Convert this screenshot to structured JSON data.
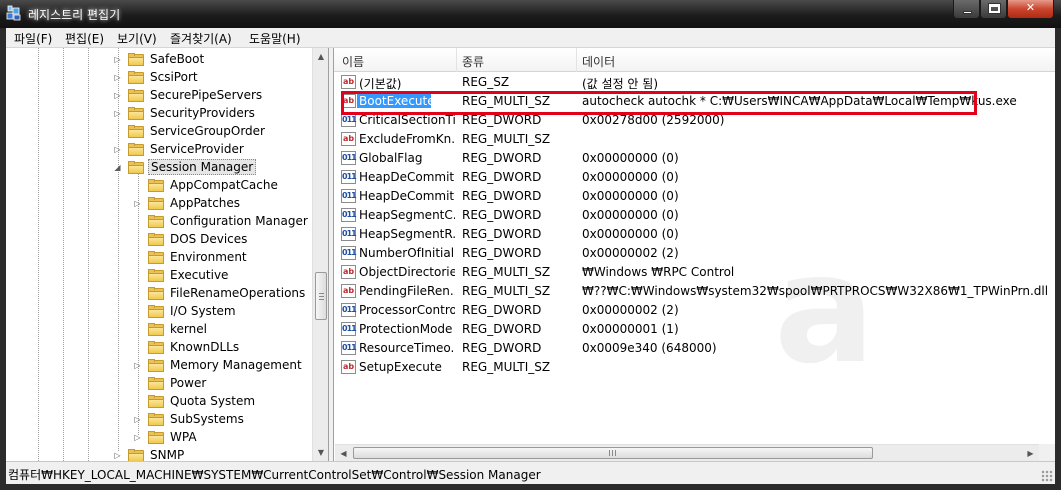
{
  "window": {
    "title": "레지스트리 편집기",
    "icon": "registry-editor-icon"
  },
  "menu": [
    "파일(F)",
    "편집(E)",
    "보기(V)",
    "즐겨찾기(A)",
    "도움말(H)"
  ],
  "tree": {
    "items": [
      {
        "label": "SafeBoot",
        "expander": "▷",
        "level": 1
      },
      {
        "label": "ScsiPort",
        "expander": "▷",
        "level": 1
      },
      {
        "label": "SecurePipeServers",
        "expander": "▷",
        "level": 1
      },
      {
        "label": "SecurityProviders",
        "expander": "▷",
        "level": 1
      },
      {
        "label": "ServiceGroupOrder",
        "expander": "",
        "level": 1
      },
      {
        "label": "ServiceProvider",
        "expander": "▷",
        "level": 1
      },
      {
        "label": "Session Manager",
        "expander": "◢",
        "level": 1,
        "selected": true
      },
      {
        "label": "AppCompatCache",
        "expander": "",
        "level": 2
      },
      {
        "label": "AppPatches",
        "expander": "▷",
        "level": 2
      },
      {
        "label": "Configuration Manager",
        "expander": "",
        "level": 2
      },
      {
        "label": "DOS Devices",
        "expander": "",
        "level": 2
      },
      {
        "label": "Environment",
        "expander": "",
        "level": 2
      },
      {
        "label": "Executive",
        "expander": "",
        "level": 2
      },
      {
        "label": "FileRenameOperations",
        "expander": "",
        "level": 2
      },
      {
        "label": "I/O System",
        "expander": "",
        "level": 2
      },
      {
        "label": "kernel",
        "expander": "",
        "level": 2
      },
      {
        "label": "KnownDLLs",
        "expander": "",
        "level": 2
      },
      {
        "label": "Memory Management",
        "expander": "▷",
        "level": 2
      },
      {
        "label": "Power",
        "expander": "",
        "level": 2
      },
      {
        "label": "Quota System",
        "expander": "",
        "level": 2
      },
      {
        "label": "SubSystems",
        "expander": "▷",
        "level": 2
      },
      {
        "label": "WPA",
        "expander": "▷",
        "level": 2
      },
      {
        "label": "SNMP",
        "expander": "▷",
        "level": 1
      }
    ]
  },
  "list": {
    "columns": [
      "이름",
      "종류",
      "데이터"
    ],
    "rows": [
      {
        "name": "(기본값)",
        "type": "REG_SZ",
        "data": "(값 설정 안 됨)",
        "icon": "ab"
      },
      {
        "name": "BootExecute",
        "type": "REG_MULTI_SZ",
        "data": "autocheck autochk * C:₩Users₩INCA₩AppData₩Local₩Temp₩kus.exe",
        "icon": "ab",
        "selected": true
      },
      {
        "name": "CriticalSectionTi...",
        "type": "REG_DWORD",
        "data": "0x00278d00 (2592000)",
        "icon": "bin"
      },
      {
        "name": "ExcludeFromKn...",
        "type": "REG_MULTI_SZ",
        "data": "",
        "icon": "ab"
      },
      {
        "name": "GlobalFlag",
        "type": "REG_DWORD",
        "data": "0x00000000 (0)",
        "icon": "bin"
      },
      {
        "name": "HeapDeCommit...",
        "type": "REG_DWORD",
        "data": "0x00000000 (0)",
        "icon": "bin"
      },
      {
        "name": "HeapDeCommit...",
        "type": "REG_DWORD",
        "data": "0x00000000 (0)",
        "icon": "bin"
      },
      {
        "name": "HeapSegmentC...",
        "type": "REG_DWORD",
        "data": "0x00000000 (0)",
        "icon": "bin"
      },
      {
        "name": "HeapSegmentR...",
        "type": "REG_DWORD",
        "data": "0x00000000 (0)",
        "icon": "bin"
      },
      {
        "name": "NumberOfInitial...",
        "type": "REG_DWORD",
        "data": "0x00000002 (2)",
        "icon": "bin"
      },
      {
        "name": "ObjectDirectories",
        "type": "REG_MULTI_SZ",
        "data": "₩Windows ₩RPC Control",
        "icon": "ab"
      },
      {
        "name": "PendingFileRen...",
        "type": "REG_MULTI_SZ",
        "data": "₩??₩C:₩Windows₩system32₩spool₩PRTPROCS₩W32X86₩1_TPWinPrn.dll",
        "icon": "ab"
      },
      {
        "name": "ProcessorControl",
        "type": "REG_DWORD",
        "data": "0x00000002 (2)",
        "icon": "bin"
      },
      {
        "name": "ProtectionMode",
        "type": "REG_DWORD",
        "data": "0x00000001 (1)",
        "icon": "bin"
      },
      {
        "name": "ResourceTimeo...",
        "type": "REG_DWORD",
        "data": "0x0009e340 (648000)",
        "icon": "bin"
      },
      {
        "name": "SetupExecute",
        "type": "REG_MULTI_SZ",
        "data": "",
        "icon": "ab"
      }
    ]
  },
  "status": {
    "path": "컴퓨터₩HKEY_LOCAL_MACHINE₩SYSTEM₩CurrentControlSet₩Control₩Session Manager"
  },
  "colors": {
    "highlight_box": "#e2001a",
    "selection": "#3399ff"
  }
}
